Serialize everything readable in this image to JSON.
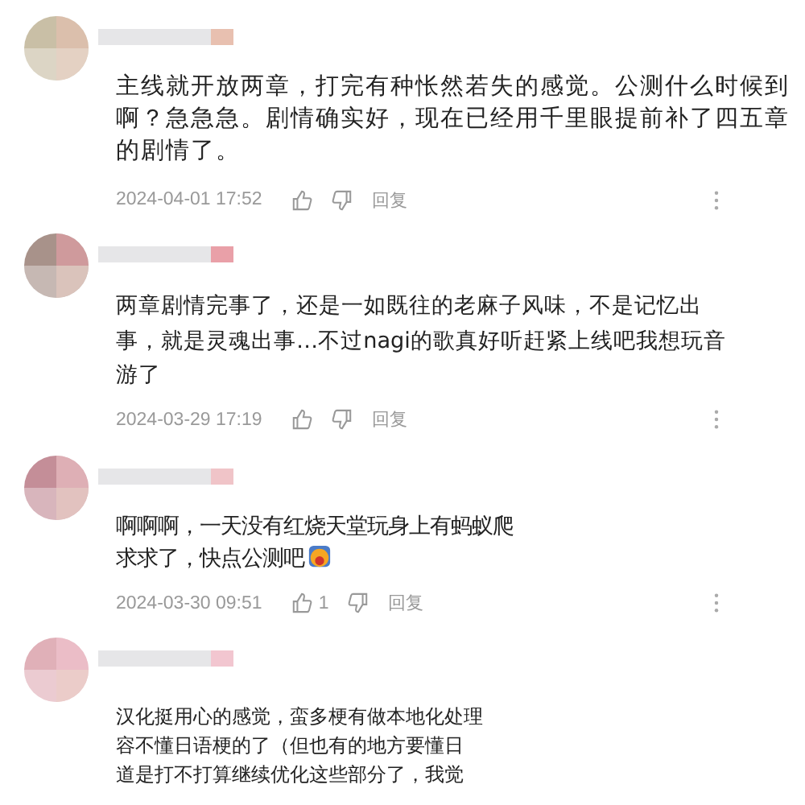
{
  "comments": [
    {
      "lines": [
        "主线就开放两章，打完有种怅然若失的感觉。公测什么时候到",
        "啊？急急急。剧情确实好，现在已经用千里眼提前补了四五章",
        "的剧情了。"
      ],
      "time": "2024-04-01 17:52",
      "reply": "回复"
    },
    {
      "lines": [
        "两章剧情完事了，还是一如既往的老麻子风味，不是记忆出",
        "事，就是灵魂出事…不过nagi的歌真好听赶紧上线吧我想玩音",
        "游了"
      ],
      "time": "2024-03-29 17:19",
      "reply": "回复"
    },
    {
      "lines": [
        "啊啊啊，一天没有红烧天堂玩身上有蚂蚁爬",
        "求求了，快点公测吧"
      ],
      "emoji": true,
      "time": "2024-03-30 09:51",
      "likes": "1",
      "reply": "回复"
    },
    {
      "lines": [
        "汉化挺用心的感觉，蛮多梗有做本地化处理",
        "容不懂日语梗的了（但也有的地方要懂日",
        "道是打不打算继续优化这些部分了，我觉"
      ]
    }
  ]
}
